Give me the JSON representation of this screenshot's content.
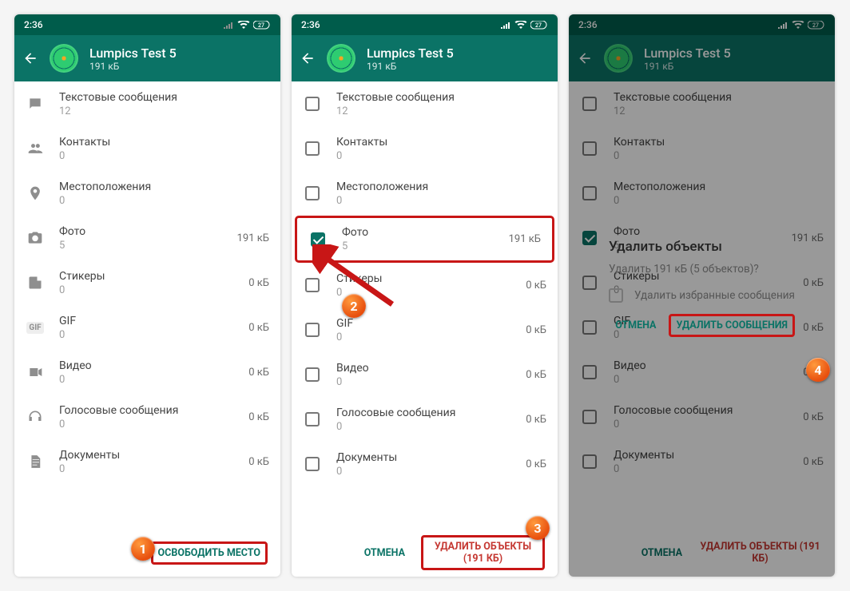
{
  "statusbar": {
    "time": "2:36"
  },
  "header": {
    "title": "Lumpics Test 5",
    "subtitle": "191 кБ"
  },
  "items": [
    {
      "label": "Текстовые сообщения",
      "count": "12",
      "size": ""
    },
    {
      "label": "Контакты",
      "count": "0",
      "size": ""
    },
    {
      "label": "Местоположения",
      "count": "0",
      "size": ""
    },
    {
      "label": "Фото",
      "count": "5",
      "size": "191 кБ"
    },
    {
      "label": "Стикеры",
      "count": "0",
      "size": "0 кБ"
    },
    {
      "label": "GIF",
      "count": "0",
      "size": "0 кБ"
    },
    {
      "label": "Видео",
      "count": "0",
      "size": "0 кБ"
    },
    {
      "label": "Голосовые сообщения",
      "count": "0",
      "size": "0 кБ"
    },
    {
      "label": "Документы",
      "count": "0",
      "size": "0 кБ"
    }
  ],
  "footer": {
    "free_space": "ОСВОБОДИТЬ МЕСТО",
    "cancel": "ОТМЕНА",
    "delete_objects": "УДАЛИТЬ ОБЪЕКТЫ (191 КБ)"
  },
  "dialog": {
    "title": "Удалить объекты",
    "message": "Удалить 191 кБ (5 объектов)?",
    "option": "Удалить избранные сообщения",
    "cancel": "ОТМЕНА",
    "confirm": "УДАЛИТЬ СООБЩЕНИЯ"
  },
  "steps": {
    "s1": "1",
    "s2": "2",
    "s3": "3",
    "s4": "4"
  }
}
